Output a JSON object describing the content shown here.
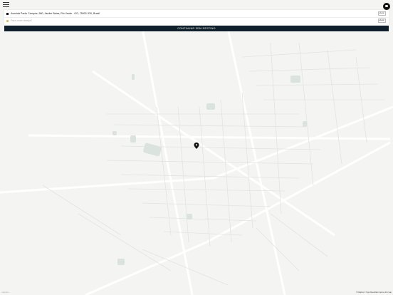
{
  "header": {
    "menu_icon": "hamburger-icon",
    "profile_icon": "account-icon"
  },
  "route": {
    "origin_text": "Avenida Paulo Campos, 580, Jardim Belas, Rio Verde - GO, 75902-330, Brasil",
    "destination_placeholder": "Para onde deseja?",
    "change_label": "alterar"
  },
  "actions": {
    "continue_label": "CONTINUAR SEM DESTINO"
  },
  "map": {
    "brand": "mapbox",
    "attribution": "© Mapbox © OpenStreetMap  Improve this map",
    "marker_icon": "location-pin-icon",
    "marker_color": "#111111"
  },
  "colors": {
    "continue_bg": "#0f1f2b",
    "destination_dot": "#d8b23a"
  }
}
